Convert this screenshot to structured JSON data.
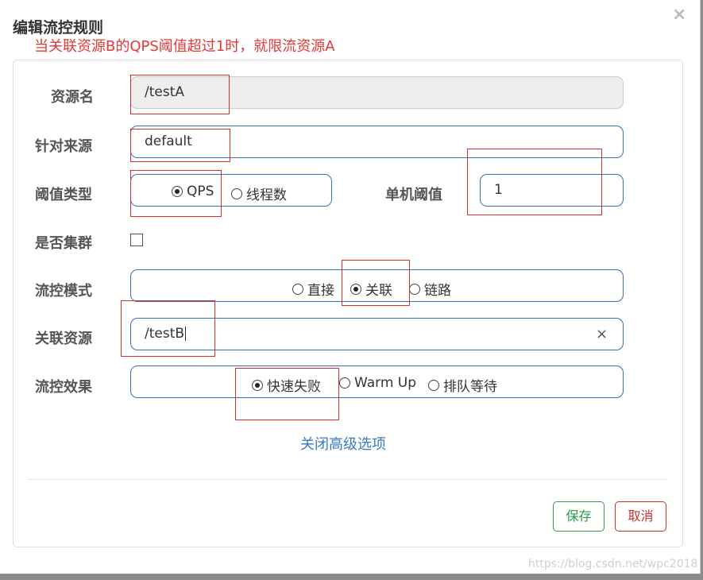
{
  "dialog": {
    "title": "编辑流控规则",
    "annotation": "当关联资源B的QPS阈值超过1时，就限流资源A",
    "close": "×"
  },
  "form": {
    "resource": {
      "label": "资源名",
      "value": "/testA"
    },
    "origin": {
      "label": "针对来源",
      "value": "default"
    },
    "threshold_type": {
      "label": "阈值类型",
      "options": [
        "QPS",
        "线程数"
      ],
      "selected": "QPS"
    },
    "single_threshold": {
      "label": "单机阈值",
      "value": "1"
    },
    "cluster": {
      "label": "是否集群",
      "checked": false
    },
    "flow_mode": {
      "label": "流控模式",
      "options": [
        "直接",
        "关联",
        "链路"
      ],
      "selected": "关联"
    },
    "related_resource": {
      "label": "关联资源",
      "value": "/testB",
      "clear": "×"
    },
    "control_effect": {
      "label": "流控效果",
      "options": [
        "快速失败",
        "Warm Up",
        "排队等待"
      ],
      "selected": "快速失败"
    },
    "advanced_link": "关闭高级选项"
  },
  "buttons": {
    "save": "保存",
    "cancel": "取消"
  },
  "watermark": "https://blog.csdn.net/wpc2018",
  "colors": {
    "annotation": "#e53935",
    "save": "#2e9a4a",
    "cancel": "#c9302c",
    "border": "#3a6fb5",
    "highlight": "#d32f2f"
  }
}
